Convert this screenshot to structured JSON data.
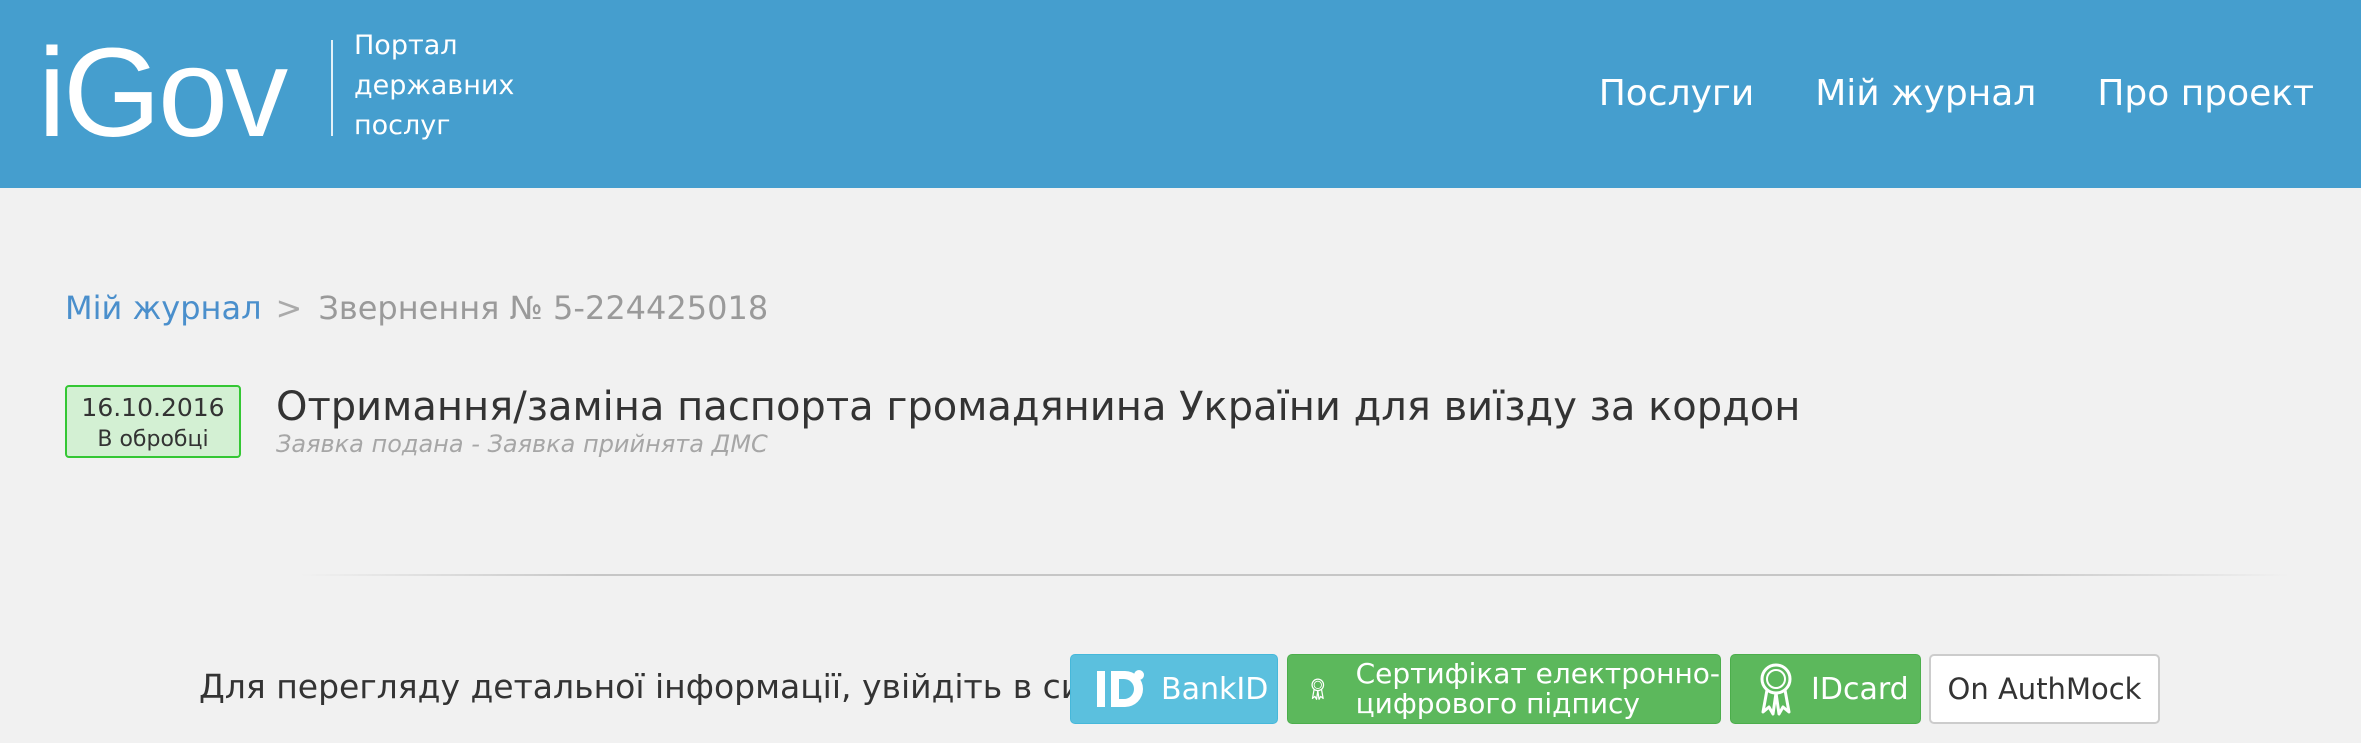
{
  "header": {
    "logo_text": "iGov",
    "tagline": [
      "Портал",
      "державних",
      "послуг"
    ],
    "nav": [
      {
        "label": "Послуги"
      },
      {
        "label": "Мій журнал"
      },
      {
        "label": "Про проект"
      }
    ]
  },
  "breadcrumb": {
    "link_label": "Мій журнал",
    "separator": ">",
    "current": "Звернення № 5-224425018"
  },
  "request": {
    "date": "16.10.2016",
    "status": "В обробці",
    "title": "Отримання/заміна паспорта громадянина України для виїзду за кордон",
    "subtitle": "Заявка подана - Заявка прийнята ДМС"
  },
  "login": {
    "prompt": "Для перегляду детальної інформації, увійдіть в систему",
    "buttons": {
      "bankid": {
        "label": "BankID",
        "icon": "bankid-logo-icon"
      },
      "certificate": {
        "label_lines": [
          "Сертифікат електронно-",
          "цифрового підпису"
        ],
        "icon": "award-icon"
      },
      "idcard": {
        "label": "IDcard",
        "icon": "award-icon"
      },
      "authmock": {
        "label": "On AuthMock"
      }
    }
  },
  "colors": {
    "header_bg": "#459ece",
    "page_bg": "#f1f1f1",
    "link": "#4a8fcc",
    "badge_bg": "#d3f0d3",
    "badge_border": "#34c734",
    "btn_info": "#5bc0de",
    "btn_success": "#5cb85c"
  }
}
